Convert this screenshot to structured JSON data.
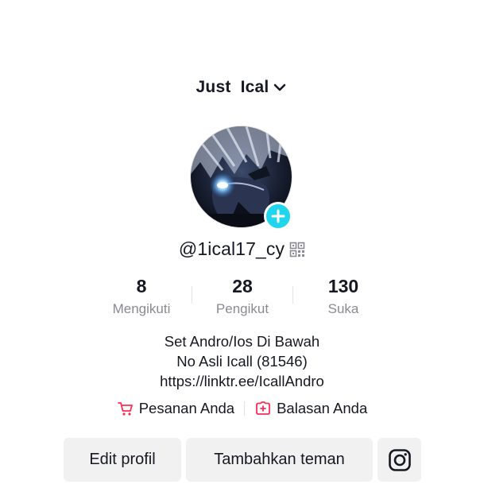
{
  "header": {
    "account_name": "Just  Ical"
  },
  "profile": {
    "username": "@1ical17_cy"
  },
  "stats": [
    {
      "value": "8",
      "label": "Mengikuti"
    },
    {
      "value": "28",
      "label": "Pengikut"
    },
    {
      "value": "130",
      "label": "Suka"
    }
  ],
  "bio": {
    "lines": [
      "Set Andro/Ios Di Bawah",
      "No Asli Icall (81546)",
      "https://linktr.ee/IcallAndro"
    ]
  },
  "quick_links": {
    "orders_label": "Pesanan Anda",
    "replies_label": "Balasan Anda"
  },
  "actions": {
    "edit_label": "Edit profil",
    "add_friends_label": "Tambahkan teman",
    "instagram_icon": "instagram-icon"
  },
  "colors": {
    "accent_cyan": "#20d5ec",
    "brand_red": "#fe2c55",
    "text_primary": "#161823",
    "text_secondary": "#8a8b91",
    "button_bg": "#f1f1f2"
  }
}
